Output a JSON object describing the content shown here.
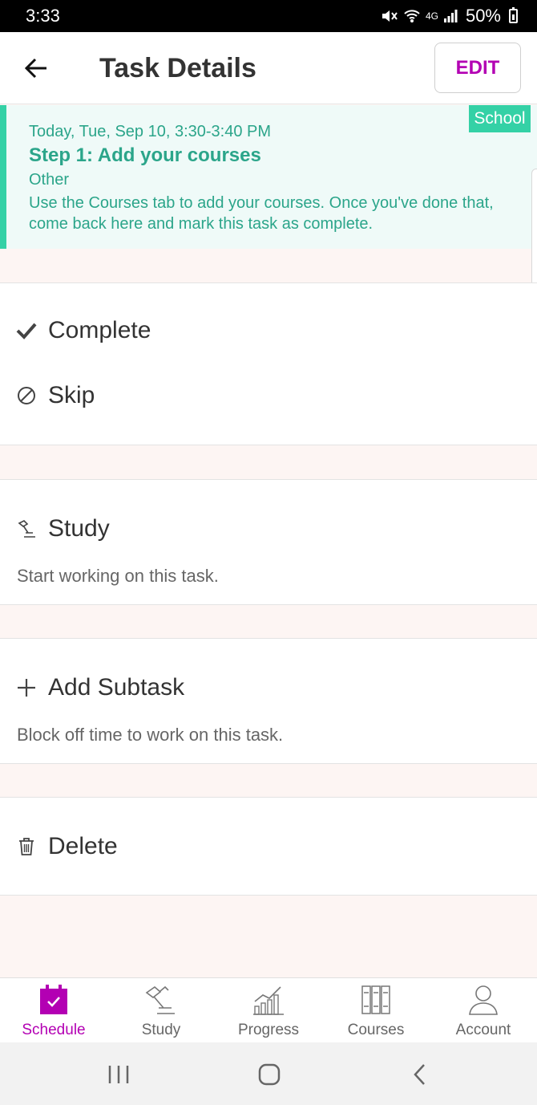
{
  "status_bar": {
    "time": "3:33",
    "network": "4G",
    "battery": "50%"
  },
  "header": {
    "title": "Task Details",
    "edit_label": "EDIT"
  },
  "task": {
    "tag": "School",
    "date": "Today, Tue, Sep 10, 3:30-3:40 PM",
    "name": "Step 1: Add your courses",
    "category": "Other",
    "description": "Use the Courses tab to add your courses. Once you've done that, come back here and mark this task as complete.",
    "accent_color": "#34d1a6"
  },
  "actions": {
    "complete_label": "Complete",
    "skip_label": "Skip",
    "study_label": "Study",
    "study_hint": "Start working on this task.",
    "add_subtask_label": "Add Subtask",
    "add_subtask_hint": "Block off time to work on this task.",
    "delete_label": "Delete"
  },
  "bottom_nav": {
    "active_color": "#b300b3",
    "items": [
      {
        "label": "Schedule",
        "icon": "calendar-check-icon",
        "active": true
      },
      {
        "label": "Study",
        "icon": "desk-lamp-icon",
        "active": false
      },
      {
        "label": "Progress",
        "icon": "bar-chart-icon",
        "active": false
      },
      {
        "label": "Courses",
        "icon": "books-icon",
        "active": false
      },
      {
        "label": "Account",
        "icon": "person-icon",
        "active": false
      }
    ]
  },
  "system_nav": {
    "icons": [
      "recent-apps-icon",
      "home-icon",
      "back-icon"
    ]
  }
}
